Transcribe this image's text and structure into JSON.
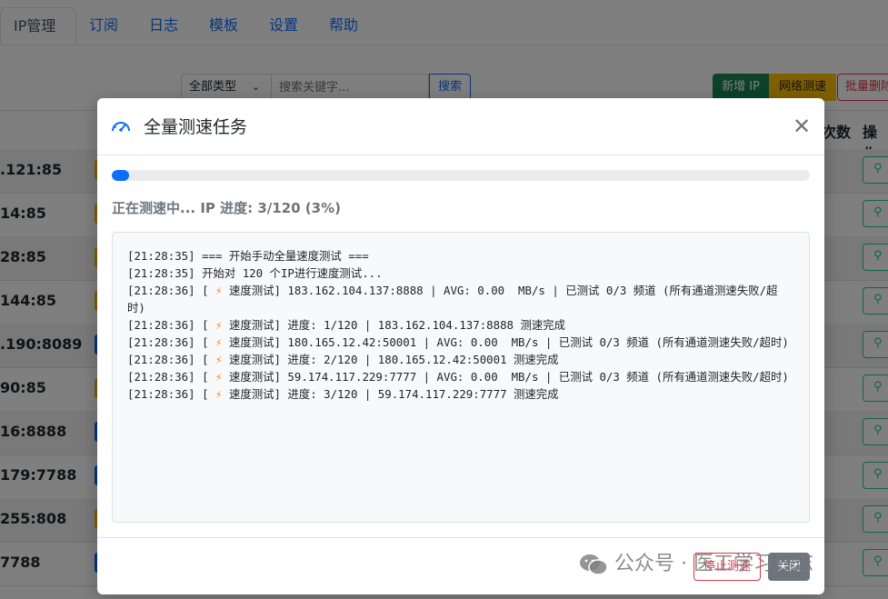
{
  "tabs": [
    "IP管理",
    "订阅",
    "日志",
    "模板",
    "设置",
    "帮助"
  ],
  "toolbar": {
    "type_select": "全部类型",
    "search_placeholder": "搜索关键字...",
    "search_button": "搜索",
    "add_button": "新增 IP",
    "net_test_button": "网络测速",
    "batch_delete_button": "批量删除"
  },
  "table": {
    "headers": {
      "count": "次数",
      "actions": "操作"
    },
    "rows": [
      {
        "ip": ".121:85",
        "pill_color": "#ffc107"
      },
      {
        "ip": "14:85",
        "pill_color": "#ffc107"
      },
      {
        "ip": "28:85",
        "pill_color": "#ffc107"
      },
      {
        "ip": "144:85",
        "pill_color": "#ffc107"
      },
      {
        "ip": ".190:8089",
        "pill_color": "#0d6efd"
      },
      {
        "ip": "90:85",
        "pill_color": "#ffc107"
      },
      {
        "ip": "16:8888",
        "pill_color": "#0d6efd"
      },
      {
        "ip": "179:7788",
        "pill_color": "#0d6efd"
      },
      {
        "ip": "255:808",
        "pill_color": "#ffc107"
      },
      {
        "ip": "7788",
        "pill_color": "#0d6efd"
      }
    ]
  },
  "modal": {
    "title": "全量测速任务",
    "progress": 0.025,
    "status": "正在测速中... IP 进度: 3/120 (3%)",
    "log": [
      {
        "time": "[21:28:35]",
        "bolt": false,
        "text": "=== 开始手动全量速度测试 ==="
      },
      {
        "time": "[21:28:35]",
        "bolt": false,
        "text": "开始对 120 个IP进行速度测试..."
      },
      {
        "time": "[21:28:36]",
        "bolt": true,
        "text": "速度测试] 183.162.104.137:8888 | AVG: 0.00  MB/s | 已测试 0/3 频道 (所有通道测速失败/超时)"
      },
      {
        "time": "[21:28:36]",
        "bolt": true,
        "text": "速度测试] 进度: 1/120 | 183.162.104.137:8888 测速完成"
      },
      {
        "time": "[21:28:36]",
        "bolt": true,
        "text": "速度测试] 180.165.12.42:50001 | AVG: 0.00  MB/s | 已测试 0/3 频道 (所有通道测速失败/超时)"
      },
      {
        "time": "[21:28:36]",
        "bolt": true,
        "text": "速度测试] 进度: 2/120 | 180.165.12.42:50001 测速完成"
      },
      {
        "time": "[21:28:36]",
        "bolt": true,
        "text": "速度测试] 59.174.117.229:7777 | AVG: 0.00  MB/s | 已测试 0/3 频道 (所有通道测速失败/超时)"
      },
      {
        "time": "[21:28:36]",
        "bolt": true,
        "text": "速度测试] 进度: 3/120 | 59.174.117.229:7777 测速完成"
      }
    ],
    "stop_button": "停止测速",
    "close_button": "关闭"
  },
  "watermark": "公众号 · 医工学习日志"
}
